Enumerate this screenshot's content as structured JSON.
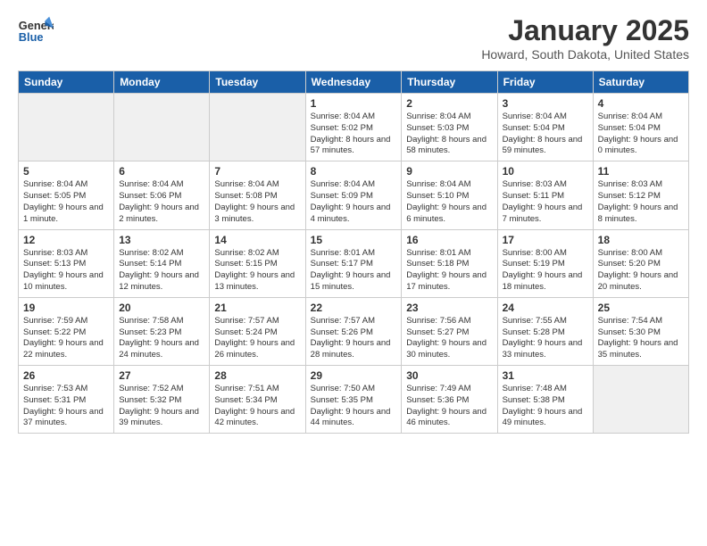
{
  "header": {
    "logo_line1": "General",
    "logo_line2": "Blue",
    "month": "January 2025",
    "location": "Howard, South Dakota, United States"
  },
  "weekdays": [
    "Sunday",
    "Monday",
    "Tuesday",
    "Wednesday",
    "Thursday",
    "Friday",
    "Saturday"
  ],
  "weeks": [
    [
      {
        "day": "",
        "info": ""
      },
      {
        "day": "",
        "info": ""
      },
      {
        "day": "",
        "info": ""
      },
      {
        "day": "1",
        "info": "Sunrise: 8:04 AM\nSunset: 5:02 PM\nDaylight: 8 hours and 57 minutes."
      },
      {
        "day": "2",
        "info": "Sunrise: 8:04 AM\nSunset: 5:03 PM\nDaylight: 8 hours and 58 minutes."
      },
      {
        "day": "3",
        "info": "Sunrise: 8:04 AM\nSunset: 5:04 PM\nDaylight: 8 hours and 59 minutes."
      },
      {
        "day": "4",
        "info": "Sunrise: 8:04 AM\nSunset: 5:04 PM\nDaylight: 9 hours and 0 minutes."
      }
    ],
    [
      {
        "day": "5",
        "info": "Sunrise: 8:04 AM\nSunset: 5:05 PM\nDaylight: 9 hours and 1 minute."
      },
      {
        "day": "6",
        "info": "Sunrise: 8:04 AM\nSunset: 5:06 PM\nDaylight: 9 hours and 2 minutes."
      },
      {
        "day": "7",
        "info": "Sunrise: 8:04 AM\nSunset: 5:08 PM\nDaylight: 9 hours and 3 minutes."
      },
      {
        "day": "8",
        "info": "Sunrise: 8:04 AM\nSunset: 5:09 PM\nDaylight: 9 hours and 4 minutes."
      },
      {
        "day": "9",
        "info": "Sunrise: 8:04 AM\nSunset: 5:10 PM\nDaylight: 9 hours and 6 minutes."
      },
      {
        "day": "10",
        "info": "Sunrise: 8:03 AM\nSunset: 5:11 PM\nDaylight: 9 hours and 7 minutes."
      },
      {
        "day": "11",
        "info": "Sunrise: 8:03 AM\nSunset: 5:12 PM\nDaylight: 9 hours and 8 minutes."
      }
    ],
    [
      {
        "day": "12",
        "info": "Sunrise: 8:03 AM\nSunset: 5:13 PM\nDaylight: 9 hours and 10 minutes."
      },
      {
        "day": "13",
        "info": "Sunrise: 8:02 AM\nSunset: 5:14 PM\nDaylight: 9 hours and 12 minutes."
      },
      {
        "day": "14",
        "info": "Sunrise: 8:02 AM\nSunset: 5:15 PM\nDaylight: 9 hours and 13 minutes."
      },
      {
        "day": "15",
        "info": "Sunrise: 8:01 AM\nSunset: 5:17 PM\nDaylight: 9 hours and 15 minutes."
      },
      {
        "day": "16",
        "info": "Sunrise: 8:01 AM\nSunset: 5:18 PM\nDaylight: 9 hours and 17 minutes."
      },
      {
        "day": "17",
        "info": "Sunrise: 8:00 AM\nSunset: 5:19 PM\nDaylight: 9 hours and 18 minutes."
      },
      {
        "day": "18",
        "info": "Sunrise: 8:00 AM\nSunset: 5:20 PM\nDaylight: 9 hours and 20 minutes."
      }
    ],
    [
      {
        "day": "19",
        "info": "Sunrise: 7:59 AM\nSunset: 5:22 PM\nDaylight: 9 hours and 22 minutes."
      },
      {
        "day": "20",
        "info": "Sunrise: 7:58 AM\nSunset: 5:23 PM\nDaylight: 9 hours and 24 minutes."
      },
      {
        "day": "21",
        "info": "Sunrise: 7:57 AM\nSunset: 5:24 PM\nDaylight: 9 hours and 26 minutes."
      },
      {
        "day": "22",
        "info": "Sunrise: 7:57 AM\nSunset: 5:26 PM\nDaylight: 9 hours and 28 minutes."
      },
      {
        "day": "23",
        "info": "Sunrise: 7:56 AM\nSunset: 5:27 PM\nDaylight: 9 hours and 30 minutes."
      },
      {
        "day": "24",
        "info": "Sunrise: 7:55 AM\nSunset: 5:28 PM\nDaylight: 9 hours and 33 minutes."
      },
      {
        "day": "25",
        "info": "Sunrise: 7:54 AM\nSunset: 5:30 PM\nDaylight: 9 hours and 35 minutes."
      }
    ],
    [
      {
        "day": "26",
        "info": "Sunrise: 7:53 AM\nSunset: 5:31 PM\nDaylight: 9 hours and 37 minutes."
      },
      {
        "day": "27",
        "info": "Sunrise: 7:52 AM\nSunset: 5:32 PM\nDaylight: 9 hours and 39 minutes."
      },
      {
        "day": "28",
        "info": "Sunrise: 7:51 AM\nSunset: 5:34 PM\nDaylight: 9 hours and 42 minutes."
      },
      {
        "day": "29",
        "info": "Sunrise: 7:50 AM\nSunset: 5:35 PM\nDaylight: 9 hours and 44 minutes."
      },
      {
        "day": "30",
        "info": "Sunrise: 7:49 AM\nSunset: 5:36 PM\nDaylight: 9 hours and 46 minutes."
      },
      {
        "day": "31",
        "info": "Sunrise: 7:48 AM\nSunset: 5:38 PM\nDaylight: 9 hours and 49 minutes."
      },
      {
        "day": "",
        "info": ""
      }
    ]
  ]
}
